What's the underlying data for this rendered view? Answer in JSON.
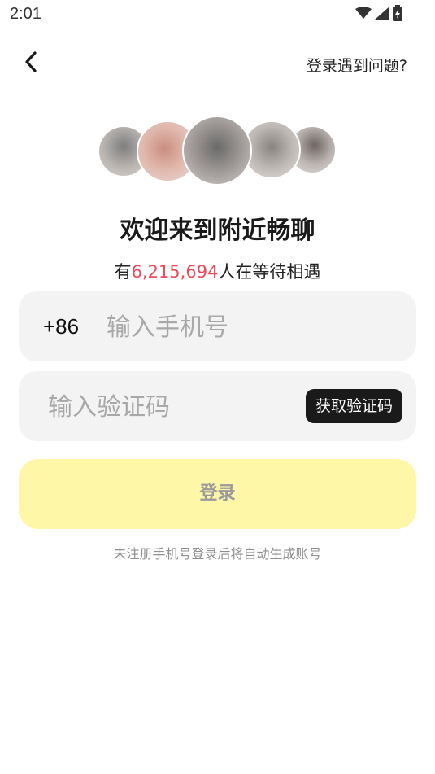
{
  "status_bar": {
    "time": "2:01"
  },
  "header": {
    "help_link": "登录遇到问题?"
  },
  "hero": {
    "title": "欢迎来到附近畅聊",
    "waiting_prefix": "有",
    "waiting_count": "6,215,694",
    "waiting_suffix": "人在等待相遇"
  },
  "phone_field": {
    "country_code": "+86",
    "placeholder": "输入手机号",
    "value": ""
  },
  "code_field": {
    "placeholder": "输入验证码",
    "value": "",
    "get_code_label": "获取验证码"
  },
  "login": {
    "label": "登录",
    "note": "未注册手机号登录后将自动生成账号"
  },
  "colors": {
    "accent_yellow": "#fff7a8",
    "highlight_red": "#f04a5a",
    "dark_button": "#1a1a1a"
  },
  "icons": {
    "back": "chevron-left-icon",
    "wifi": "wifi-icon",
    "signal": "signal-icon",
    "battery": "battery-icon"
  }
}
